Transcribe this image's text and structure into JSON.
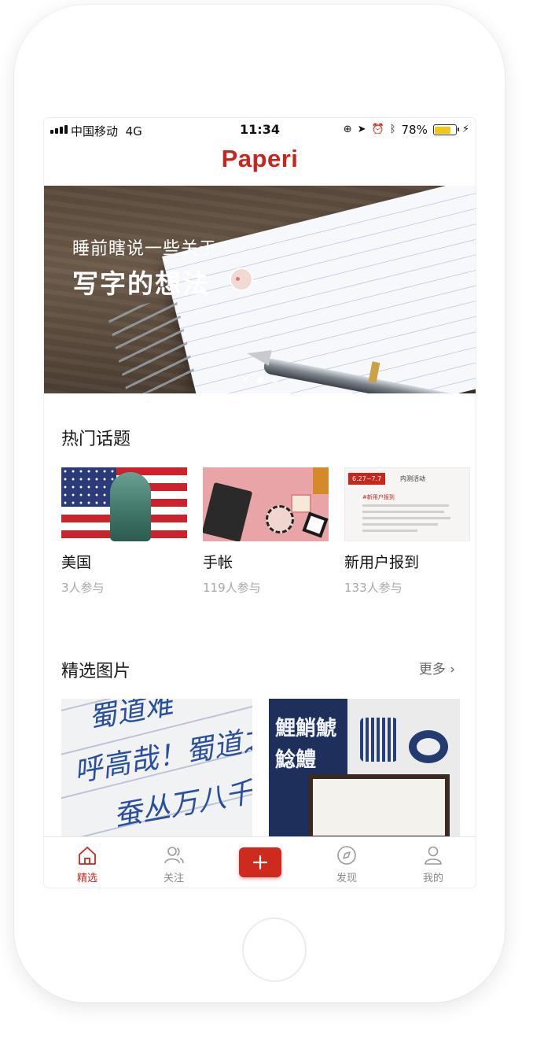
{
  "status_bar": {
    "carrier": "中国移动",
    "network": "4G",
    "time": "11:34",
    "battery_percent": "78%",
    "battery_level": 0.78
  },
  "header": {
    "title": "Paperi"
  },
  "banner": {
    "subtitle": "睡前瞎说一些关于",
    "headline": "写字的想法",
    "page_count": 3,
    "active_page": 2
  },
  "hot_topics": {
    "title": "热门话题",
    "items": [
      {
        "name": "美国",
        "count": "3人参与"
      },
      {
        "name": "手帐",
        "count": "119人参与"
      },
      {
        "name": "新用户报到",
        "count": "133人参与"
      }
    ],
    "notice_card": {
      "date": "6.27~7.7",
      "title": "内测活动",
      "tag": "#新用户报到"
    }
  },
  "featured_photos": {
    "title": "精选图片",
    "more_label": "更多",
    "photo1_text": "蜀道难\n呼高哉！蜀道之\n蚕丛万八千",
    "photo2_text": "鯉鮹鯱 鯰鱧"
  },
  "tab_bar": {
    "items": [
      {
        "label": "精选",
        "icon": "home-icon",
        "active": true
      },
      {
        "label": "关注",
        "icon": "people-icon",
        "active": false
      },
      {
        "label": "发现",
        "icon": "compass-icon",
        "active": false
      },
      {
        "label": "我的",
        "icon": "person-icon",
        "active": false
      }
    ],
    "add_icon": "plus-icon"
  },
  "colors": {
    "brand": "#c8261c",
    "text_secondary": "#a8a8a8",
    "battery": "#f5c518"
  }
}
